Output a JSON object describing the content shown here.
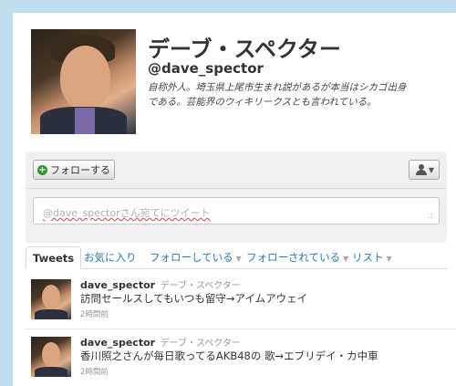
{
  "profile": {
    "name": "デーブ・スペクター",
    "handle": "@dave_spector",
    "bio_line1": "自称外人。埼玉県上尾市生まれ説があるが本当はシカゴ出身",
    "bio_line2": "である。芸能界のウィキリークスとも言われている。"
  },
  "actions": {
    "follow_label": "フォローする",
    "tweet_placeholder": "@dave_spectorさん宛てにツイート"
  },
  "tabs": [
    {
      "label": "Tweets"
    },
    {
      "label": "お気に入り"
    },
    {
      "label": "フォローしている"
    },
    {
      "label": "フォローされている"
    },
    {
      "label": "リスト"
    }
  ],
  "tweets": [
    {
      "user": "dave_spector",
      "full_name": "デーブ・スペクター",
      "text": "訪問セールスしてもいつも留守→アイムアウェイ",
      "time": "2時間前"
    },
    {
      "user": "dave_spector",
      "full_name": "デーブ・スペクター",
      "text": "香川照之さんが毎日歌ってるAKB48の 歌→エブリデイ・カ中車",
      "time": "2時間前"
    }
  ],
  "colors": {
    "background": "#c0deed",
    "link": "#2b7bb9",
    "follow_plus": "#2f9a2f"
  },
  "icons": [
    "plus-icon",
    "user-icon",
    "chevron-down-icon",
    "resize-grip-icon"
  ]
}
